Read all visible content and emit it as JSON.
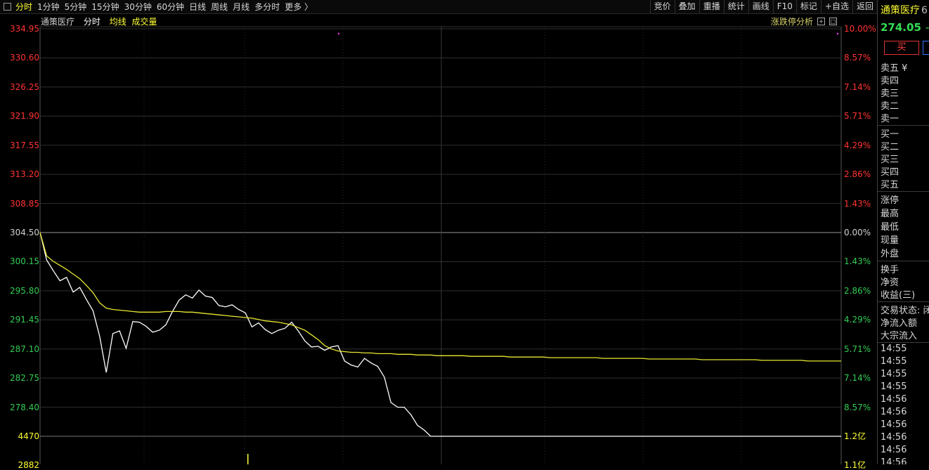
{
  "toolbar": {
    "periods": [
      "分时",
      "1分钟",
      "5分钟",
      "15分钟",
      "30分钟",
      "60分钟",
      "日线",
      "周线",
      "月线",
      "多分时",
      "更多 〉"
    ],
    "tools": [
      "竞价",
      "叠加",
      "重播",
      "统计",
      "画线",
      "F10",
      "标记",
      "+自选",
      "返回"
    ]
  },
  "chart_header": {
    "name": "通策医疗",
    "mode": "分时",
    "avg_label": "均线",
    "vol_label": "成交量"
  },
  "zdt_label": "涨跌停分析",
  "left_axis": [
    "334.95",
    "330.60",
    "326.25",
    "321.90",
    "317.55",
    "313.20",
    "308.85",
    "304.50",
    "300.15",
    "295.80",
    "291.45",
    "287.10",
    "282.75",
    "278.40",
    "4470",
    "2882"
  ],
  "right_axis": [
    "10.00%",
    "8.57%",
    "7.14%",
    "5.71%",
    "4.29%",
    "2.86%",
    "1.43%",
    "0.00%",
    "1.43%",
    "2.86%",
    "4.29%",
    "5.71%",
    "7.14%",
    "8.57%",
    "1.2亿",
    "1.1亿"
  ],
  "colors": {
    "up": "#ff3333",
    "down": "#33cc55",
    "neutral": "#d0d0d0",
    "volume": "#ffff33",
    "price_line": "#ffffff",
    "avg_line": "#e8e832"
  },
  "chart_data": {
    "type": "line",
    "y_range": [
      274.05,
      334.95
    ],
    "prev_close": 304.5,
    "series": [
      {
        "name": "分时",
        "values": [
          304.5,
          300.4,
          298.8,
          297.3,
          297.8,
          295.6,
          296.3,
          294.5,
          292.8,
          289.0,
          283.6,
          289.4,
          289.8,
          287.2,
          291.2,
          291.1,
          290.5,
          289.6,
          289.9,
          290.7,
          292.7,
          294.4,
          295.2,
          294.7,
          295.9,
          295.0,
          294.8,
          293.6,
          293.4,
          293.7,
          293.0,
          292.5,
          290.4,
          291.0,
          290.0,
          289.4,
          289.9,
          290.2,
          291.1,
          289.8,
          288.3,
          287.4,
          287.5,
          286.9,
          287.4,
          287.6,
          285.3,
          284.7,
          284.4,
          285.7,
          285.0,
          284.5,
          282.9,
          279.1,
          278.4,
          278.4,
          277.3,
          275.7,
          275.0,
          274.05,
          274.05,
          274.05,
          274.05,
          274.05,
          274.05,
          274.05,
          274.05,
          274.05,
          274.05,
          274.05,
          274.05,
          274.05,
          274.05,
          274.05,
          274.05,
          274.05,
          274.05,
          274.05,
          274.05,
          274.05,
          274.05,
          274.05,
          274.05,
          274.05,
          274.05,
          274.05,
          274.05,
          274.05,
          274.05,
          274.05,
          274.05,
          274.05,
          274.05,
          274.05,
          274.05,
          274.05,
          274.05,
          274.05,
          274.05,
          274.05,
          274.05,
          274.05,
          274.05,
          274.05,
          274.05,
          274.05,
          274.05,
          274.05,
          274.05,
          274.05,
          274.05,
          274.05,
          274.05,
          274.05,
          274.05,
          274.05,
          274.05,
          274.05,
          274.05,
          274.05,
          274.05,
          274.05
        ]
      },
      {
        "name": "均线",
        "values": [
          304.5,
          301.0,
          300.2,
          299.6,
          299.0,
          298.3,
          297.6,
          296.6,
          295.5,
          294.0,
          293.2,
          293.0,
          292.9,
          292.8,
          292.7,
          292.6,
          292.6,
          292.6,
          292.6,
          292.7,
          292.7,
          292.7,
          292.6,
          292.6,
          292.5,
          292.4,
          292.3,
          292.2,
          292.1,
          292.0,
          291.9,
          291.8,
          291.7,
          291.5,
          291.3,
          291.2,
          291.1,
          290.9,
          290.7,
          290.3,
          289.9,
          289.2,
          288.5,
          287.6,
          287.1,
          286.8,
          286.7,
          286.6,
          286.6,
          286.5,
          286.5,
          286.4,
          286.4,
          286.4,
          286.3,
          286.3,
          286.3,
          286.2,
          286.2,
          286.2,
          286.1,
          286.1,
          286.1,
          286.1,
          286.1,
          286.0,
          286.0,
          286.0,
          286.0,
          286.0,
          286.0,
          285.9,
          285.9,
          285.9,
          285.9,
          285.9,
          285.9,
          285.8,
          285.8,
          285.8,
          285.8,
          285.8,
          285.8,
          285.8,
          285.8,
          285.7,
          285.7,
          285.7,
          285.7,
          285.7,
          285.7,
          285.7,
          285.6,
          285.6,
          285.6,
          285.6,
          285.6,
          285.6,
          285.6,
          285.6,
          285.5,
          285.5,
          285.5,
          285.5,
          285.5,
          285.5,
          285.5,
          285.5,
          285.5,
          285.4,
          285.4,
          285.4,
          285.4,
          285.4,
          285.4,
          285.4,
          285.3,
          285.3,
          285.3,
          285.3,
          285.3,
          285.3
        ]
      }
    ]
  },
  "panel": {
    "stock_name": "通策医疗",
    "stock_code": "6",
    "price": "274.05",
    "change": "-",
    "buy_btn": "买",
    "ask": [
      "卖五 ¥",
      "卖四",
      "卖三",
      "卖二",
      "卖一"
    ],
    "bid": [
      "买一",
      "买二",
      "买三",
      "买四",
      "买五"
    ],
    "stats1": [
      "涨停",
      "最高",
      "最低",
      "现量",
      "外盘"
    ],
    "stats2": [
      "换手",
      "净资",
      "收益(三)"
    ],
    "stats3": [
      "交易状态: 闭",
      "净流入额",
      "大宗流入"
    ],
    "times": [
      "14:55",
      "14:55",
      "14:55",
      "14:55",
      "14:56",
      "14:56",
      "14:56",
      "14:56",
      "14:56",
      "14:56"
    ]
  }
}
